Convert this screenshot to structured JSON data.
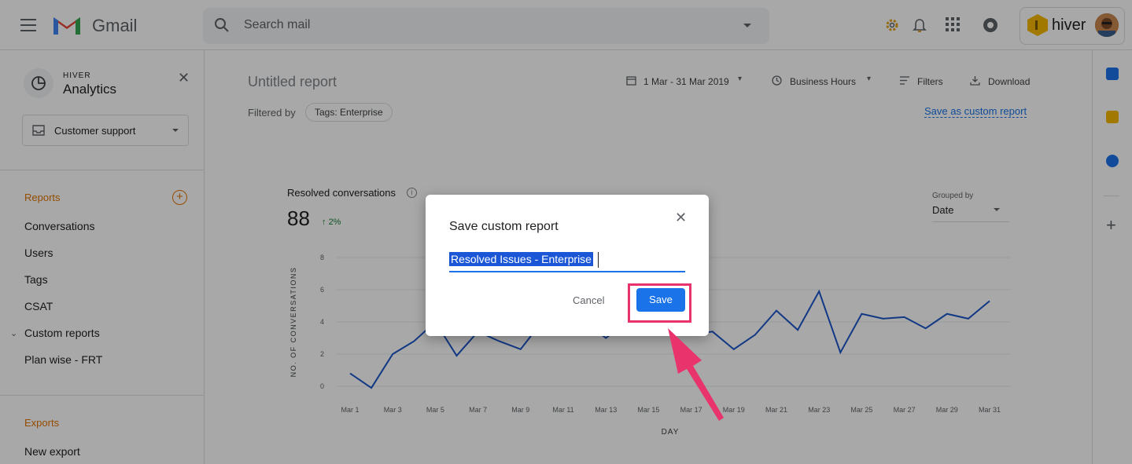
{
  "gmail": {
    "brand": "Gmail",
    "search_placeholder": "Search mail"
  },
  "hiver": {
    "brand": "hiver",
    "header_small": "HIVER",
    "header_title": "Analytics",
    "inbox_select": "Customer support"
  },
  "sidebar": {
    "reports_heading": "Reports",
    "items": [
      "Conversations",
      "Users",
      "Tags",
      "CSAT",
      "Custom reports",
      "Plan wise - FRT"
    ],
    "exports_heading": "Exports",
    "exports_items": [
      "New export"
    ]
  },
  "report": {
    "title": "Untitled report",
    "filtered_by_label": "Filtered by",
    "filter_chip": "Tags: Enterprise",
    "date_range": "1 Mar - 31 Mar 2019",
    "hours": "Business Hours",
    "filters": "Filters",
    "download": "Download",
    "save_custom": "Save as custom report"
  },
  "metric": {
    "title": "Resolved conversations",
    "value": "88",
    "delta": "2%",
    "grouped_by_label": "Grouped by",
    "grouped_by_value": "Date"
  },
  "chart_data": {
    "type": "line",
    "xlabel": "DAY",
    "ylabel": "NO. OF CONVERSATIONS",
    "ylim": [
      0,
      8
    ],
    "yticks": [
      0,
      2,
      4,
      6,
      8
    ],
    "x": [
      "Mar 1",
      "Mar 2",
      "Mar 3",
      "Mar 4",
      "Mar 5",
      "Mar 6",
      "Mar 7",
      "Mar 8",
      "Mar 9",
      "Mar 10",
      "Mar 11",
      "Mar 12",
      "Mar 13",
      "Mar 14",
      "Mar 15",
      "Mar 16",
      "Mar 17",
      "Mar 18",
      "Mar 19",
      "Mar 20",
      "Mar 21",
      "Mar 22",
      "Mar 23",
      "Mar 24",
      "Mar 25",
      "Mar 26",
      "Mar 27",
      "Mar 28",
      "Mar 29",
      "Mar 30",
      "Mar 31"
    ],
    "x_tick_labels": [
      "Mar 1",
      "Mar 3",
      "Mar 5",
      "Mar 7",
      "Mar 9",
      "Mar 11",
      "Mar 13",
      "Mar 15",
      "Mar 17",
      "Mar 19",
      "Mar 21",
      "Mar 23",
      "Mar 25",
      "Mar 27",
      "Mar 29",
      "Mar 31"
    ],
    "series": [
      {
        "color": "#1a56c8",
        "values": [
          0.8,
          -0.1,
          2.0,
          2.8,
          4.0,
          1.9,
          3.4,
          2.8,
          2.3,
          4.0,
          3.4,
          4.0,
          3.0,
          4.0,
          3.6,
          4.0,
          3.2,
          3.4,
          2.3,
          3.2,
          4.7,
          3.5,
          5.9,
          2.1,
          4.5,
          4.2,
          4.3,
          3.6,
          4.5,
          4.2,
          5.3
        ]
      }
    ]
  },
  "dialog": {
    "title": "Save custom report",
    "input_value": "Resolved Issues - Enterprise",
    "cancel": "Cancel",
    "save": "Save"
  },
  "colors": {
    "accent": "#1a73e8",
    "highlight": "#e8336d",
    "reports_orange": "#e37400"
  }
}
